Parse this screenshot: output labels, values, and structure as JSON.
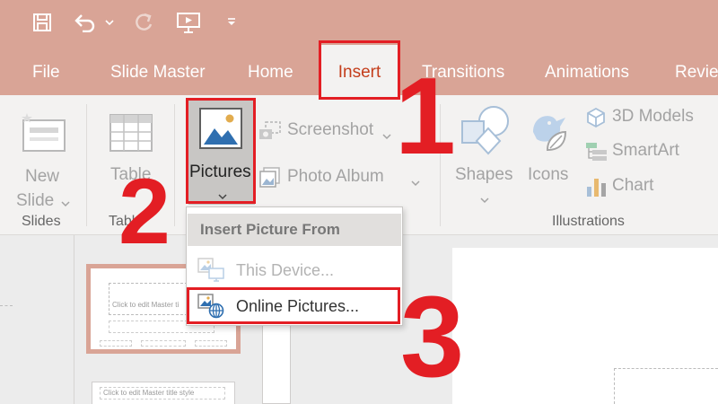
{
  "qat": {
    "save": "save-icon",
    "undo": "undo-icon",
    "redo": "redo-icon",
    "present": "present-from-start-icon",
    "customize": "customize-qat-icon"
  },
  "tabs": [
    "File",
    "Slide Master",
    "Home",
    "Insert",
    "Transitions",
    "Animations",
    "Revie"
  ],
  "active_tab": "Insert",
  "ribbon": {
    "new_slide_line1": "New",
    "new_slide_line2": "Slide",
    "slides_group": "Slides",
    "table": "Table",
    "tables_group": "Table",
    "pictures": "Pictures",
    "screenshot": "Screenshot",
    "photo_album": "Photo Album",
    "shapes": "Shapes",
    "icons": "Icons",
    "models_3d": "3D Models",
    "smartart": "SmartArt",
    "chart": "Chart",
    "illustrations_group": "Illustrations"
  },
  "dropdown": {
    "header": "Insert Picture From",
    "this_device": "This Device...",
    "online_pictures": "Online Pictures..."
  },
  "thumbnails": {
    "title_placeholder": "Click to edit Master title style",
    "title_placeholder_short": "Click to edit Master ti"
  },
  "steps": {
    "one": "1",
    "two": "2",
    "three": "3"
  },
  "colors": {
    "accent": "#d9a496",
    "active_tab_text": "#c43e1c",
    "highlight": "#e31e24",
    "ribbon_bg": "#f3f2f1"
  }
}
